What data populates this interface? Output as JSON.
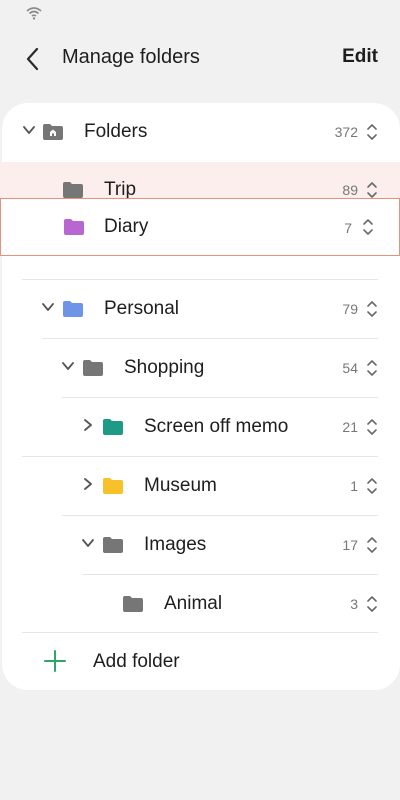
{
  "header": {
    "title": "Manage folders",
    "edit_label": "Edit"
  },
  "colors": {
    "grey_folder": "#767676",
    "purple": "#b867d0",
    "blue": "#6d94e6",
    "teal": "#1f9a86",
    "yellow": "#f6c12a",
    "plus": "#2fa56a",
    "highlight": "#fbeeec",
    "drag_border": "#e8917c"
  },
  "tree": {
    "root": {
      "label": "Folders",
      "count": "372",
      "icon": "home-folder-icon"
    },
    "trip": {
      "label": "Trip",
      "count": "89"
    },
    "diary": {
      "label": "Diary",
      "count": "7"
    },
    "personal": {
      "label": "Personal",
      "count": "79"
    },
    "shopping": {
      "label": "Shopping",
      "count": "54"
    },
    "screen_off_memo": {
      "label": "Screen off memo",
      "count": "21"
    },
    "museum": {
      "label": "Museum",
      "count": "1"
    },
    "images": {
      "label": "Images",
      "count": "17"
    },
    "animal": {
      "label": "Animal",
      "count": "3"
    }
  },
  "add_folder_label": "Add folder"
}
